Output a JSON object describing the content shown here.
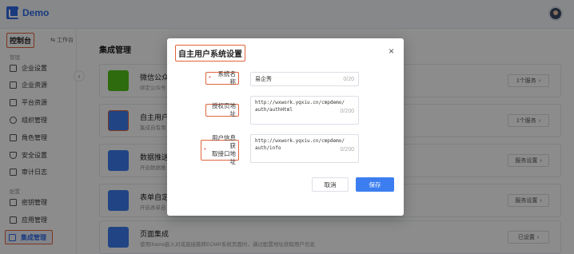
{
  "app": {
    "logo_text": "Demo"
  },
  "sidebar": {
    "title": "控制台",
    "workbench_label": "工作台",
    "groups": [
      "管理",
      "配置"
    ],
    "items": [
      {
        "label": "企业设置",
        "icon": "building-icon"
      },
      {
        "label": "企业资源",
        "icon": "folder-icon"
      },
      {
        "label": "平台资源",
        "icon": "login-icon"
      },
      {
        "label": "组织管理",
        "icon": "users-icon"
      },
      {
        "label": "角色管理",
        "icon": "role-icon"
      },
      {
        "label": "安全设置",
        "icon": "shield-icon"
      },
      {
        "label": "审计日志",
        "icon": "log-icon"
      },
      {
        "label": "密钥管理",
        "icon": "key-icon"
      },
      {
        "label": "应用管理",
        "icon": "apps-icon"
      },
      {
        "label": "集成管理",
        "icon": "layers-icon",
        "active": true
      }
    ]
  },
  "main": {
    "title": "集成管理",
    "cards": [
      {
        "name": "微信公众号",
        "desc": "绑定公众号",
        "button": "1个服务",
        "color": "#52c41a"
      },
      {
        "name": "自主用户系",
        "desc": "集成自有用",
        "button": "1个服务",
        "color": "#3c7ef0"
      },
      {
        "name": "数据推送服",
        "desc": "开启数据推",
        "button": "服务设置",
        "color": "#3c7ef0"
      },
      {
        "name": "表单自定义",
        "desc": "开启表单自",
        "button": "服务设置",
        "color": "#3c7ef0"
      },
      {
        "name": "页面集成",
        "desc": "使用iframe嵌入对或直接跳转ECMP系统页面时，通过配置地址获取用户信息",
        "button": "已设置",
        "color": "#3c7ef0"
      }
    ]
  },
  "modal": {
    "title": "自主用户系统设置",
    "close": "×",
    "fields": [
      {
        "label": "系统名称",
        "required": true,
        "value": "易企秀",
        "count": "0/20"
      },
      {
        "label": "授权页地址",
        "required": false,
        "value": "http://wxwork.yqxiu.cn/cmpdemo/auth/authHtml",
        "count": "0/200"
      },
      {
        "label_line1": "用户信息获",
        "label_line2": "取接口地址",
        "required": true,
        "value": "http://wxwork.yqxiu.cn/cmpdemo/auth/info",
        "count": "0/200"
      }
    ],
    "cancel_label": "取消",
    "save_label": "保存"
  },
  "colors": {
    "accent": "#3c7ef0",
    "highlight": "#e0643c",
    "required": "#e53935"
  }
}
